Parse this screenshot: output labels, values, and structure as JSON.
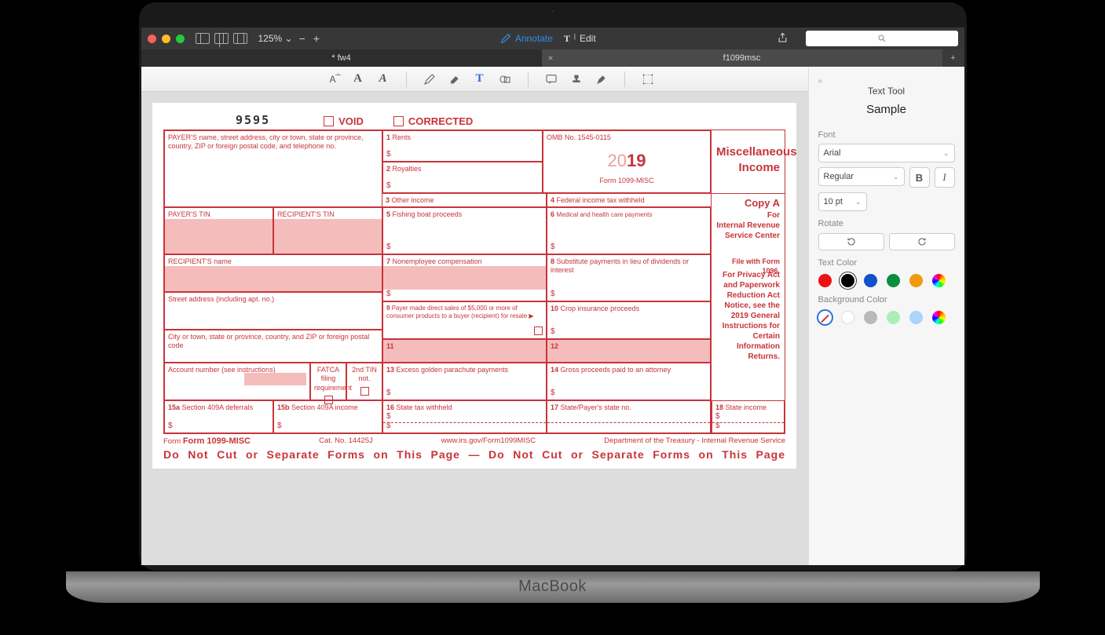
{
  "toolbar": {
    "zoom": "125% ⌄",
    "annotate": "Annotate",
    "edit": "Edit"
  },
  "tabs": {
    "t1": "* fw4",
    "t2": "f1099msc"
  },
  "panel": {
    "title": "Text Tool",
    "sample": "Sample",
    "font_label": "Font",
    "font_family": "Arial",
    "font_style": "Regular",
    "font_size": "10 pt",
    "rotate_label": "Rotate",
    "text_color_label": "Text Color",
    "bg_color_label": "Background Color"
  },
  "form": {
    "code": "9595",
    "void": "VOID",
    "corrected": "CORRECTED",
    "payer": "PAYER'S name, street address, city or town, state or province, country, ZIP or foreign postal code, and telephone no.",
    "omb": "OMB No. 1545-0115",
    "year_a": "20",
    "year_b": "19",
    "formname": "Form 1099-MISC",
    "title1": "Miscellaneous",
    "title2": "Income",
    "b1": "1",
    "b1l": "Rents",
    "b2": "2",
    "b2l": "Royalties",
    "b3": "3",
    "b3l": "Other income",
    "b4": "4",
    "b4l": "Federal income tax withheld",
    "payertin": "PAYER'S TIN",
    "rectin": "RECIPIENT'S TIN",
    "b5": "5",
    "b5l": "Fishing boat proceeds",
    "b6": "6",
    "b6l": "Medical and health care payments",
    "recname": "RECIPIENT'S name",
    "b7": "7",
    "b7l": "Nonemployee compensation",
    "b8": "8",
    "b8l": "Substitute payments in lieu of dividends or interest",
    "street": "Street address (including apt. no.)",
    "b9": "9",
    "b9l": "Payer made direct sales of $5,000 or more of consumer products to a buyer (recipient) for resale ▶",
    "b10": "10",
    "b10l": "Crop insurance proceeds",
    "city": "City or town, state or province, country, and ZIP or foreign postal code",
    "b11": "11",
    "b12": "12",
    "acct": "Account number (see instructions)",
    "fatca": "FATCA filing requirement",
    "tin2": "2nd TIN not.",
    "b13": "13",
    "b13l": "Excess golden parachute payments",
    "b14": "14",
    "b14l": "Gross proceeds paid to an attorney",
    "b15a": "15a",
    "b15al": "Section 409A deferrals",
    "b15b": "15b",
    "b15bl": "Section 409A income",
    "b16": "16",
    "b16l": "State tax withheld",
    "b17": "17",
    "b17l": "State/Payer's state no.",
    "b18": "18",
    "b18l": "State income",
    "copy": "Copy A",
    "r1": "For",
    "r2": "Internal Revenue",
    "r3": "Service Center",
    "r4": "File with Form 1096.",
    "r5": "For Privacy Act and Paperwork Reduction Act Notice, see the 2019 General Instructions for Certain Information Returns.",
    "foot_form": "Form 1099-MISC",
    "foot_cat": "Cat. No. 14425J",
    "foot_url": "www.irs.gov/Form1099MISC",
    "foot_dept": "Department of the Treasury - Internal Revenue Service",
    "bigfoot": "Do Not Cut or Separate Forms on This Page — Do Not Cut or Separate Forms on This Page"
  }
}
